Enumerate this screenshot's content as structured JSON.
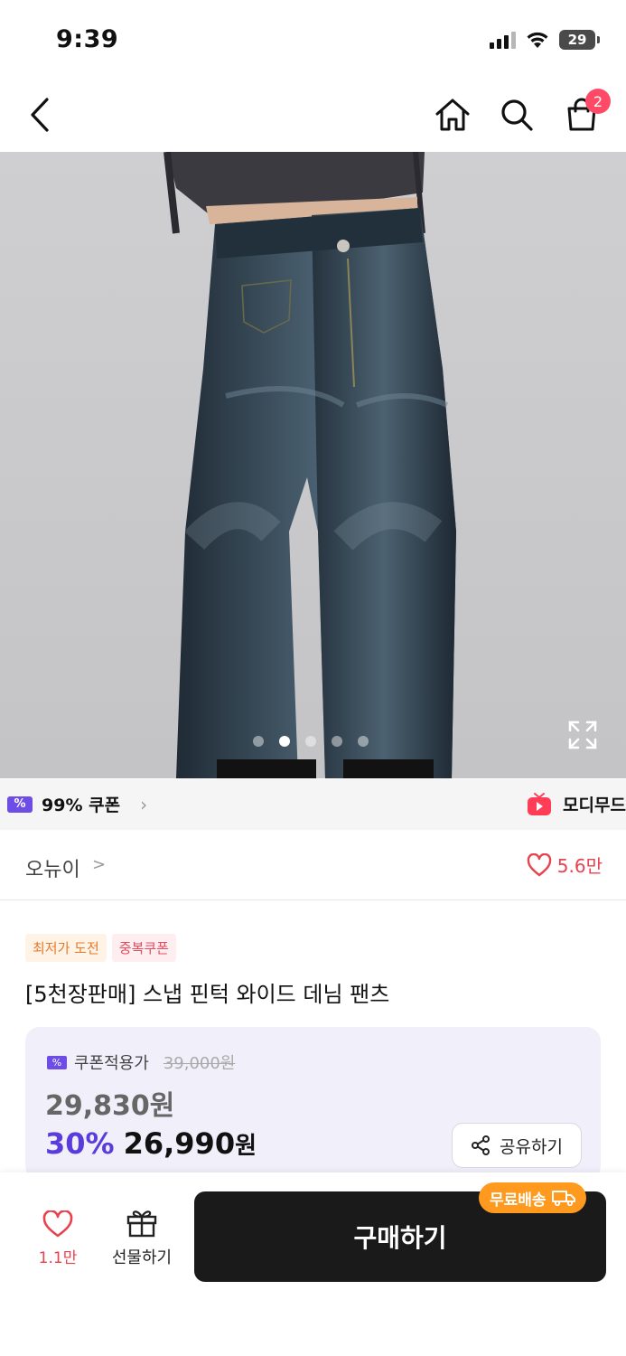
{
  "status_bar": {
    "time": "9:39",
    "battery": "29"
  },
  "nav": {
    "cart_count": "2"
  },
  "gallery": {
    "dot_count": 5,
    "active_index": 1
  },
  "coupon_strip": {
    "label": "99% 쿠폰",
    "moody_label": "모디무드"
  },
  "brand": {
    "name": "오뉴이",
    "like_count": "5.6만"
  },
  "product": {
    "tags": [
      "최저가 도전",
      "중복쿠폰"
    ],
    "title": "[5천장판매] 스냅 핀턱 와이드 데님 팬츠"
  },
  "price": {
    "coupon_label": "쿠폰적용가",
    "original": "39,000원",
    "coupon_price": "29,830원",
    "discount": "30%",
    "final": "26,990",
    "currency": "원",
    "share_label": "공유하기"
  },
  "bottom_bar": {
    "like_count": "1.1만",
    "gift_label": "선물하기",
    "buy_label": "구매하기",
    "free_shipping_label": "무료배송"
  },
  "colors": {
    "accent_purple": "#5a3bdb",
    "like_red": "#e8424f",
    "badge_pink": "#ff4a67",
    "free_ship_orange": "#ff9a1f"
  }
}
